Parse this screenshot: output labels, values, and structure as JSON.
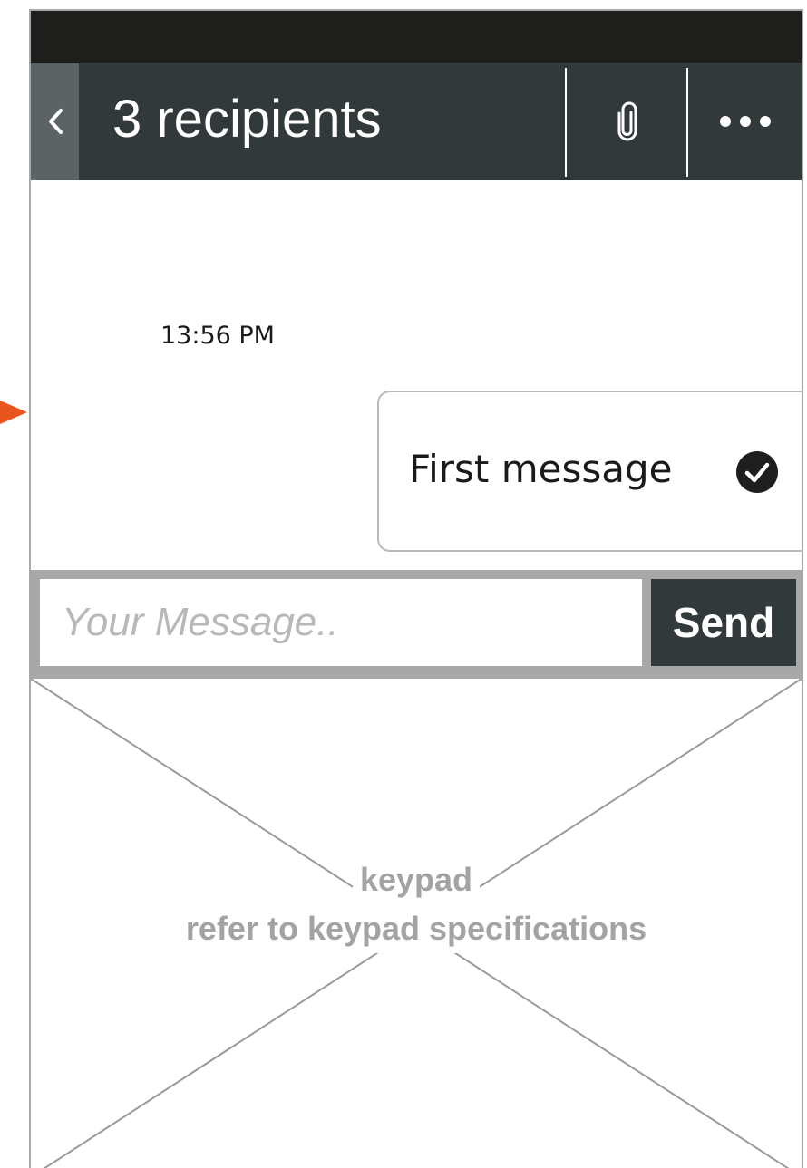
{
  "header": {
    "title": "3 recipients",
    "back_icon": "chevron-left-icon",
    "attach_icon": "paperclip-icon",
    "more_icon": "more-horizontal-icon",
    "background_color": "#32393b",
    "back_background_color": "#5c6365"
  },
  "conversation": {
    "timestamp": "13:56 PM",
    "messages": [
      {
        "text": "First message",
        "status_icon": "check-circle-icon"
      }
    ]
  },
  "composer": {
    "placeholder": "Your Message..",
    "value": "",
    "send_label": "Send"
  },
  "keypad": {
    "title": "keypad",
    "subtitle": "refer to keypad specifications"
  },
  "annotation": {
    "arrow_color": "#e8561e"
  }
}
